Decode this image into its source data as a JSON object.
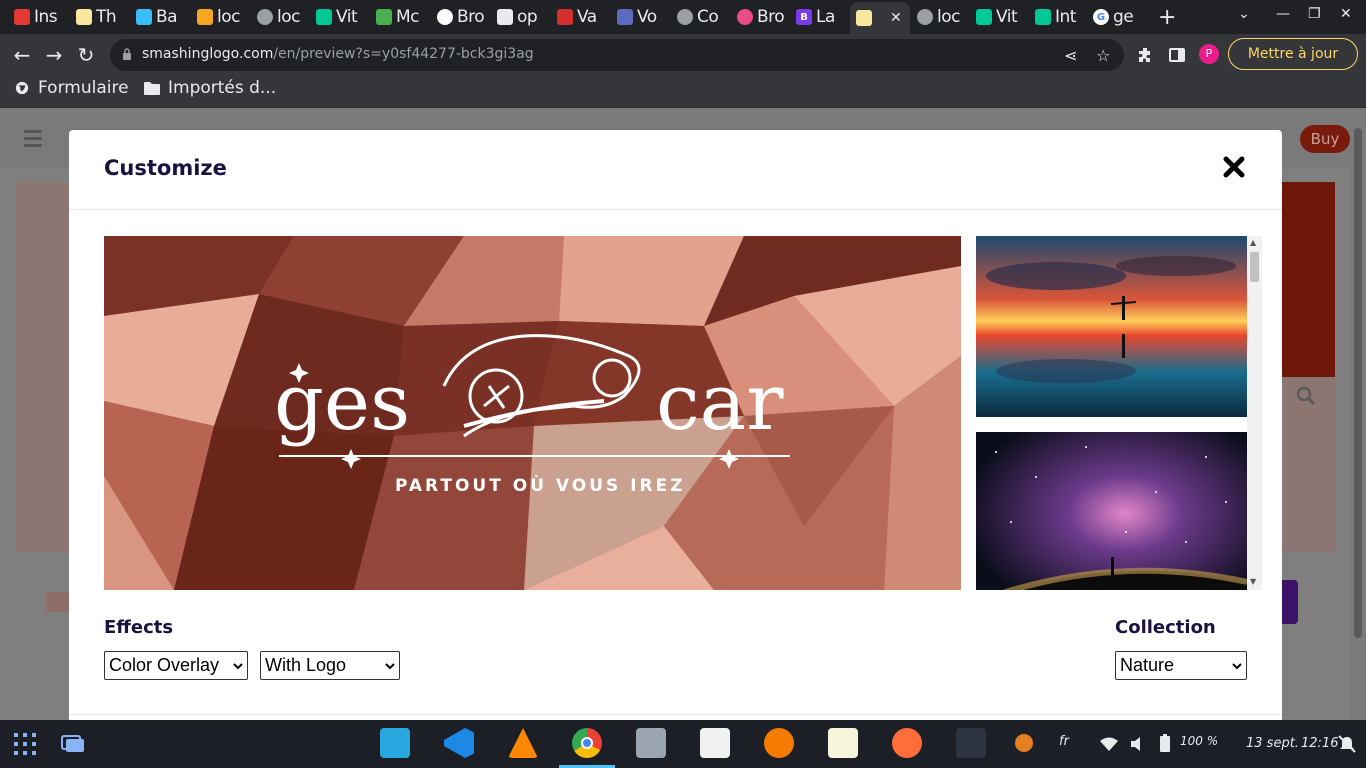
{
  "browser": {
    "tabs": [
      {
        "label": "Ins",
        "favicon_color": "#e53935"
      },
      {
        "label": "Th",
        "favicon_color": "#f9e79f"
      },
      {
        "label": "Ba",
        "favicon_color": "#38bdf8"
      },
      {
        "label": "loc",
        "favicon_color": "#f5a623"
      },
      {
        "label": "loc",
        "favicon_color": "#9aa0a6"
      },
      {
        "label": "Vit",
        "favicon_color": "#00c897"
      },
      {
        "label": "Mc",
        "favicon_color": "#4caf50"
      },
      {
        "label": "Bro",
        "favicon_color": "#ffffff"
      },
      {
        "label": "op",
        "favicon_color": "#e8eaed"
      },
      {
        "label": "Va",
        "favicon_color": "#d32f2f"
      },
      {
        "label": "Vo",
        "favicon_color": "#5c6bc0"
      },
      {
        "label": "Co",
        "favicon_color": "#9aa0a6"
      },
      {
        "label": "Bro",
        "favicon_color": "#ea4c89"
      },
      {
        "label": "La",
        "favicon_color": "#7c3aed"
      },
      {
        "label": "",
        "favicon_color": "#f9e79f"
      },
      {
        "label": "loc",
        "favicon_color": "#9aa0a6"
      },
      {
        "label": "Vit",
        "favicon_color": "#00c897"
      },
      {
        "label": "Int",
        "favicon_color": "#00c897"
      },
      {
        "label": "ge",
        "favicon_color": "#4285f4"
      }
    ],
    "new_tab": "+",
    "url_host": "smashinglogo.com",
    "url_path": "/en/preview?s=y0sf44277-bck3gi3ag",
    "profile_initial": "P",
    "update_label": "Mettre à jour",
    "bookmarks": [
      {
        "label": "Formulaire"
      },
      {
        "label": "Importés d..."
      }
    ]
  },
  "page": {
    "buy_label": "Buy"
  },
  "modal": {
    "title": "Customize",
    "preview": {
      "logo_word_left": "ges",
      "logo_word_right": "car",
      "tagline": "PARTOUT OÙ VOUS IREZ"
    },
    "effects": {
      "label": "Effects",
      "overlay_value": "Color Overlay",
      "logo_value": "With Logo"
    },
    "collection": {
      "label": "Collection",
      "value": "Nature"
    }
  },
  "taskbar": {
    "keyboard_layout": "fr",
    "battery": "100 %",
    "date": "13 sept.",
    "time": "12:16"
  },
  "colors": {
    "modal_title": "#1a1140",
    "buy_button": "#c0341d",
    "update_outline": "#fdd663"
  }
}
